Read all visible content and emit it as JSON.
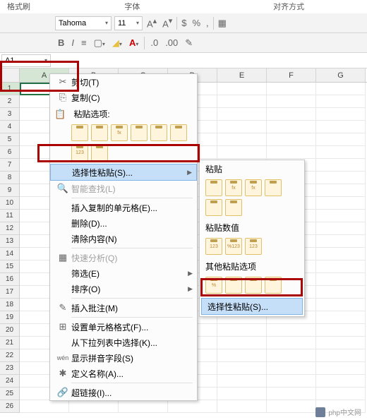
{
  "ribbon": {
    "tab_partial": "格式刷",
    "groups": [
      "字体",
      "对齐方式"
    ],
    "font_name": "Tahoma",
    "font_size": "11"
  },
  "name_box": "A1",
  "columns": [
    "A",
    "B",
    "C",
    "D",
    "E",
    "F",
    "G"
  ],
  "rows": [
    "1",
    "2",
    "3",
    "4",
    "5",
    "6",
    "7",
    "8",
    "9",
    "10",
    "11",
    "12",
    "13",
    "14",
    "15",
    "16",
    "17",
    "18",
    "19",
    "20",
    "21",
    "22",
    "23",
    "24",
    "25",
    "26"
  ],
  "context_menu": {
    "cut": "剪切(T)",
    "copy": "复制(C)",
    "paste_options_header": "粘贴选项:",
    "paste_special": "选择性粘贴(S)...",
    "smart_lookup": "智能查找(L)",
    "insert_copied": "插入复制的单元格(E)...",
    "delete": "删除(D)...",
    "clear": "清除内容(N)",
    "quick_analysis": "快速分析(Q)",
    "filter": "筛选(E)",
    "sort": "排序(O)",
    "insert_comment": "插入批注(M)",
    "format_cells": "设置单元格格式(F)...",
    "dropdown_select": "从下拉列表中选择(K)...",
    "show_pinyin": "显示拼音字段(S)",
    "define_name": "定义名称(A)...",
    "hyperlink": "超链接(I)..."
  },
  "paste_icons": [
    "",
    "",
    "fx",
    "",
    "",
    "",
    "123",
    ""
  ],
  "submenu": {
    "paste_header": "粘贴",
    "paste_icons1": [
      "",
      "fx",
      "fx",
      "",
      "",
      ""
    ],
    "paste_values_header": "粘贴数值",
    "paste_icons2": [
      "123",
      "%123",
      "123"
    ],
    "other_options_header": "其他粘贴选项",
    "paste_icons3": [
      "%",
      "",
      "",
      ""
    ],
    "paste_special": "选择性粘贴(S)..."
  },
  "watermark": "php中文网"
}
